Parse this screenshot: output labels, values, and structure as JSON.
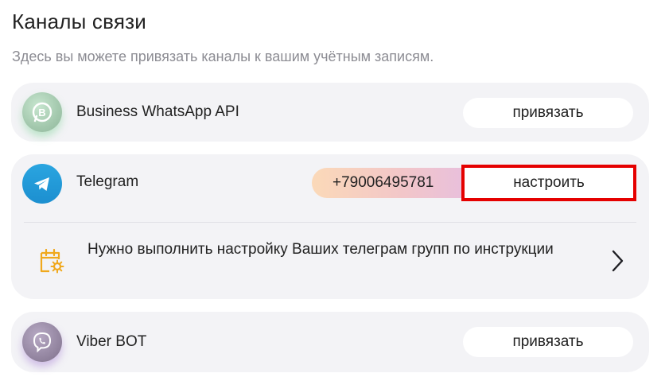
{
  "page": {
    "title": "Каналы связи",
    "subtitle": "Здесь вы можете привязать каналы к вашим учётным записям."
  },
  "channels": {
    "whatsapp": {
      "name": "Business WhatsApp API",
      "button": "привязать",
      "icon": "whatsapp-business-icon"
    },
    "telegram": {
      "name": "Telegram",
      "phone": "+79006495781",
      "button": "настроить",
      "icon": "telegram-icon",
      "notice": "Нужно выполнить настройку Ваших телеграм групп по инструкции",
      "notice_icon": "calendar-gear-icon"
    },
    "viber": {
      "name": "Viber BOT",
      "button": "привязать",
      "icon": "viber-icon"
    }
  },
  "colors": {
    "card_bg": "#f3f3f6",
    "highlight": "#e50000",
    "telegram_blue": "#2aa5e0",
    "notice_icon": "#f0a81c"
  }
}
